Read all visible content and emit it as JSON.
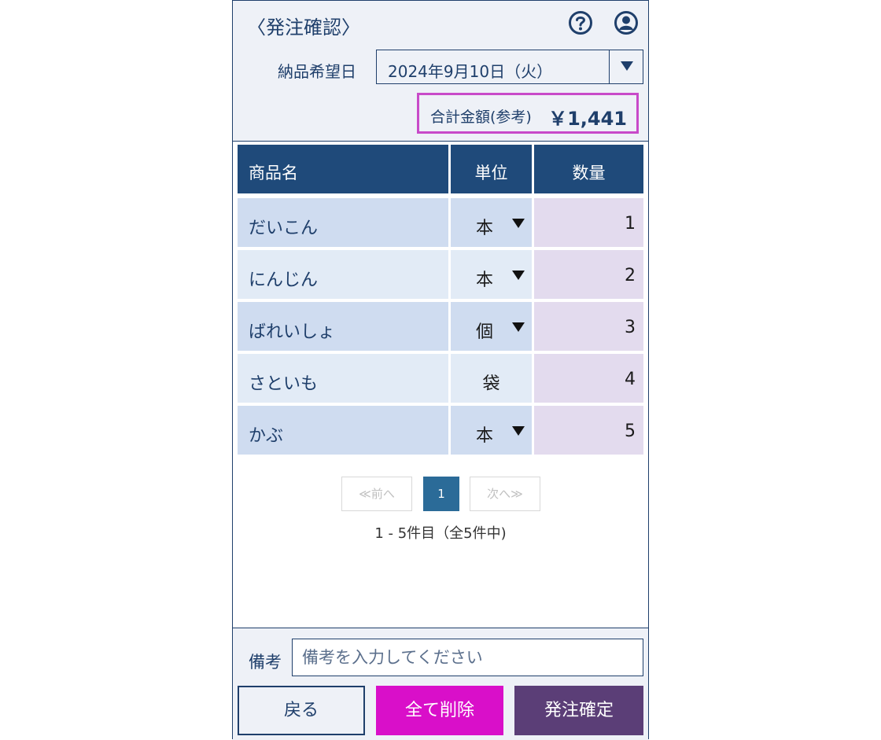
{
  "header": {
    "title": "〈発注確認〉",
    "help_icon": "question-circle-icon",
    "user_icon": "user-circle-icon"
  },
  "delivery": {
    "label": "納品希望日",
    "value": "2024年9月10日（火）"
  },
  "total": {
    "label": "合計金額(参考)",
    "value": "￥1,441"
  },
  "table": {
    "headers": {
      "name": "商品名",
      "unit": "単位",
      "qty": "数量"
    },
    "rows": [
      {
        "name": "だいこん",
        "unit": "本",
        "qty": "1"
      },
      {
        "name": "にんじん",
        "unit": "本",
        "qty": "2"
      },
      {
        "name": "ばれいしょ",
        "unit": "個",
        "qty": "3"
      },
      {
        "name": "さといも",
        "unit": "袋",
        "qty": "4"
      },
      {
        "name": "かぶ",
        "unit": "本",
        "qty": "5"
      }
    ]
  },
  "pager": {
    "prev": "≪前へ",
    "current": "1",
    "next": "次へ≫",
    "info": "1 - 5件目（全5件中)"
  },
  "memo": {
    "label": "備考",
    "placeholder": "備考を入力してください"
  },
  "buttons": {
    "back": "戻る",
    "delete_all": "全て削除",
    "confirm": "発注確定"
  },
  "colors": {
    "navy": "#1f3f6b",
    "header_bg": "#1f4a7a",
    "highlight_border": "#c84ac9",
    "delete": "#d90fc9",
    "confirm": "#5b3e77",
    "pager_active": "#2b6b98"
  }
}
